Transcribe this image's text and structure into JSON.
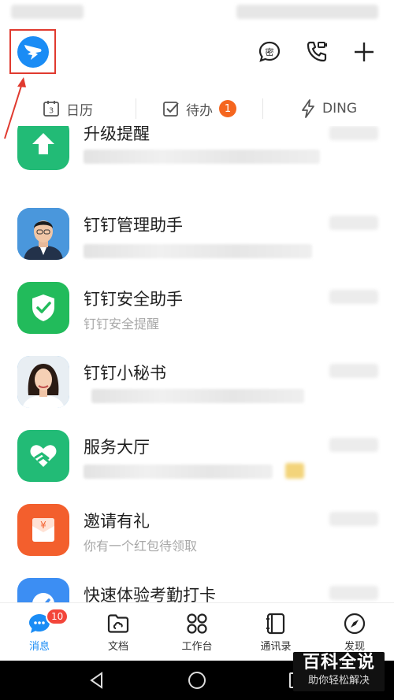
{
  "header": {
    "quick_tabs": [
      {
        "icon": "calendar-3-icon",
        "icon_text": "3",
        "label": "日历"
      },
      {
        "icon": "todo-check-icon",
        "label": "待办",
        "badge": "1"
      },
      {
        "icon": "lightning-icon",
        "label": "DING"
      }
    ]
  },
  "messages": [
    {
      "title": "升级提醒",
      "subtitle": "",
      "avatar": "upgrade-arrow-icon",
      "color": "#22bb76"
    },
    {
      "title": "钉钉管理助手",
      "subtitle": "",
      "avatar": "man-photo",
      "color": "#3d8fd8"
    },
    {
      "title": "钉钉安全助手",
      "subtitle": "钉钉安全提醒",
      "avatar": "shield-check-icon",
      "color": "#22bb5b"
    },
    {
      "title": "钉钉小秘书",
      "subtitle": "",
      "avatar": "woman-photo",
      "color": "#4aa3e8"
    },
    {
      "title": "服务大厅",
      "subtitle": "",
      "avatar": "heart-hand-icon",
      "color": "#22bb76"
    },
    {
      "title": "邀请有礼",
      "subtitle": "你有一个红包待领取",
      "avatar": "red-envelope-icon",
      "color": "#f35f2d"
    },
    {
      "title": "快速体验考勤打卡",
      "subtitle": "",
      "avatar": "check-circle-icon",
      "color": "#3c8ef3"
    }
  ],
  "tabbar": {
    "items": [
      {
        "label": "消息",
        "icon": "message-bubble-icon",
        "badge": "10",
        "active": true
      },
      {
        "label": "文档",
        "icon": "folder-cloud-icon"
      },
      {
        "label": "工作台",
        "icon": "grid-apps-icon"
      },
      {
        "label": "通讯录",
        "icon": "contacts-book-icon"
      },
      {
        "label": "发现",
        "icon": "compass-icon"
      }
    ]
  },
  "watermark": {
    "main": "百科全说",
    "sub": "助你轻松解决"
  },
  "colors": {
    "accent": "#1a8cf5",
    "badge": "#f3453a",
    "todo_badge": "#f5661f",
    "highlight": "#e03a2f"
  }
}
